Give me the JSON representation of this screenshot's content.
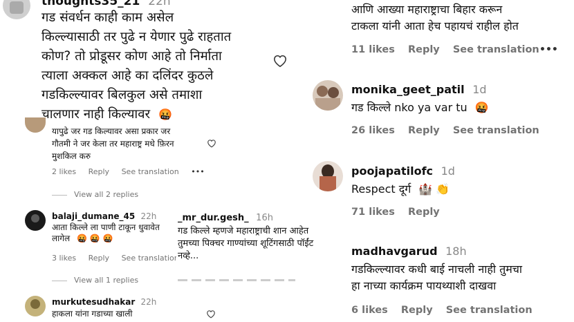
{
  "left": {
    "top_comment": {
      "username": "thoughts35_21",
      "time": "22h",
      "lines": [
        "गड संवर्धन काही काम असेल",
        "किल्ल्यासाठी तर पुढे न येणार पुढे राहतात",
        "कोण? तो प्रोडूसर कोण आहे तो निर्माता",
        "त्याला अक्कल आहे का दलिंदर कुठले",
        "गडकिल्ल्यावर बिलकुल असे तमाशा",
        "चालणार नाही किल्यावर"
      ],
      "emoji": "🤬"
    },
    "reply1": {
      "lines": [
        "यापुढे जर गड किल्यावर असा प्रकार जर",
        "गौतमी ने जर केला तर महाराष्ट्र मधे फ़िरन",
        "मुशकिल करु"
      ],
      "likes": "2 likes",
      "reply": "Reply",
      "see_translation": "See translation",
      "more": "•••",
      "view_replies": "View all 2 replies"
    },
    "comment2": {
      "username": "balaji_dumane_45",
      "time": "22h",
      "lines": [
        "आता किल्ले ला पाणी टाकून धुवावेत",
        "लागेल"
      ],
      "emojis": [
        "🤬",
        "🤬",
        "🤬"
      ],
      "likes": "3 likes",
      "reply": "Reply",
      "see_translation": "See translation",
      "view_replies": "View all 1 replies"
    },
    "comment3": {
      "username": "murkutesudhakar",
      "time": "22h",
      "lines": [
        "हाकला यांना गडाच्या खाली"
      ]
    }
  },
  "middle": {
    "username": "_mr_dur.gesh_",
    "time": "16h",
    "lines": [
      "गड किल्ले म्हणजे महाराष्ट्राची शान आहेत",
      "तुमच्या पिक्चर गाण्यांच्या शूटिंगसाठी पॉईंट",
      "नव्हे..."
    ]
  },
  "right": {
    "top": {
      "lines": [
        "आणि आख्या महाराष्ट्राचा बिहार करून",
        "टाकला यांनी आता हेच पहायचं राहील होत"
      ],
      "likes": "11 likes",
      "reply": "Reply",
      "see_translation": "See translation",
      "more": "•••"
    },
    "monika": {
      "username": "monika_geet_patil",
      "time": "1d",
      "text": "गड किल्ले nko ya var tu",
      "emoji": "🤬",
      "likes": "26 likes",
      "reply": "Reply",
      "see_translation": "See translation"
    },
    "pooja": {
      "username": "poojapatilofc",
      "time": "1d",
      "text": "Respect दूर्ग",
      "emojis": [
        "🏰",
        "👏"
      ],
      "likes": "71 likes",
      "reply": "Reply"
    },
    "madhav": {
      "username": "madhavgarud",
      "time": "18h",
      "lines": [
        "गडकिल्ल्यावर कधी बाई नाचली नाही तुमचा",
        "हा नाच्या कार्यक्रम पायथ्याशी दाखवा"
      ],
      "likes": "6 likes",
      "reply": "Reply",
      "see_translation": "See translation"
    }
  },
  "colors": {
    "text": "#111111",
    "meta": "#737373",
    "emoji_red": "#e0245e"
  }
}
